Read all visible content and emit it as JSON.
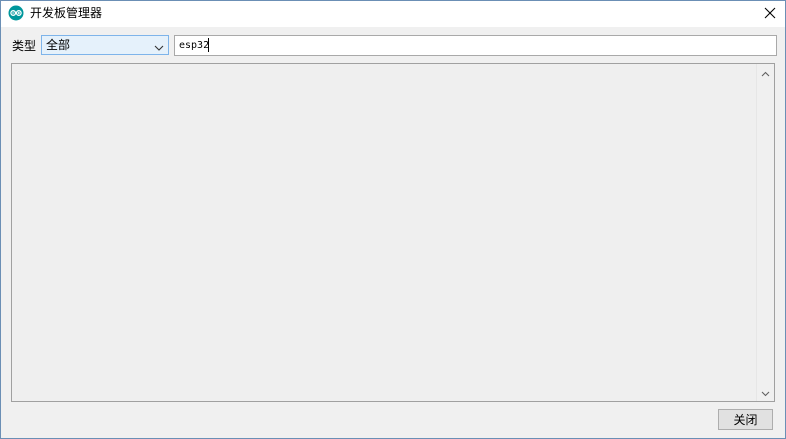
{
  "window": {
    "title": "开发板管理器",
    "app_icon": "arduino-icon",
    "close_icon": "close-icon"
  },
  "filter": {
    "type_label": "类型",
    "type_value": "全部",
    "type_chevron_icon": "chevron-down-icon",
    "search_value": "esp32"
  },
  "board_list": {
    "items": [],
    "scroll_up_icon": "chevron-up-icon",
    "scroll_down_icon": "chevron-down-icon"
  },
  "footer": {
    "close_label": "关闭"
  },
  "colors": {
    "accent_icon": "#00979c",
    "select_bg": "#e5f1fb",
    "select_border": "#7eb4ea",
    "window_bg": "#f0f0f0"
  }
}
